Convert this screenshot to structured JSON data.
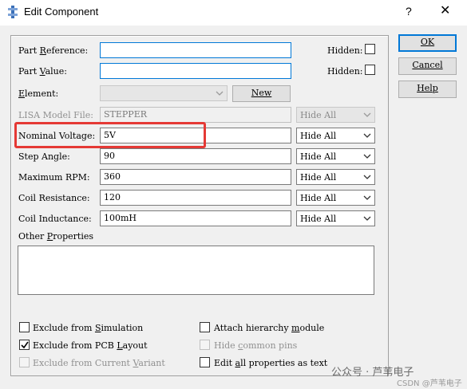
{
  "window": {
    "title": "Edit Component",
    "help_glyph": "?",
    "close_glyph": "✕"
  },
  "buttons": {
    "ok": "OK",
    "cancel": "Cancel",
    "help": "Help",
    "new": "New"
  },
  "fields": {
    "part_reference": {
      "label_pre": "Part ",
      "label_u": "R",
      "label_post": "eference:",
      "value": ""
    },
    "part_value": {
      "label_pre": "Part ",
      "label_u": "V",
      "label_post": "alue:",
      "value": ""
    },
    "element": {
      "label_pre": "",
      "label_u": "E",
      "label_post": "lement:",
      "value": ""
    },
    "hidden_label": "Hidden:"
  },
  "properties": [
    {
      "label": "LISA Model File:",
      "value": "STEPPER",
      "visibility": "Hide All",
      "disabled": true
    },
    {
      "label": "Nominal Voltage:",
      "value": "5V",
      "visibility": "Hide All",
      "disabled": false
    },
    {
      "label": "Step Angle:",
      "value": "90",
      "visibility": "Hide All",
      "disabled": false
    },
    {
      "label": "Maximum RPM:",
      "value": "360",
      "visibility": "Hide All",
      "disabled": false
    },
    {
      "label": "Coil Resistance:",
      "value": "120",
      "visibility": "Hide All",
      "disabled": false
    },
    {
      "label": "Coil Inductance:",
      "value": "100mH",
      "visibility": "Hide All",
      "disabled": false
    }
  ],
  "other_properties": {
    "label_pre": "Other ",
    "label_u": "P",
    "label_post": "roperties",
    "value": ""
  },
  "options": {
    "exclude_simulation": {
      "pre": "Exclude from ",
      "u": "S",
      "post": "imulation",
      "checked": false
    },
    "exclude_pcb": {
      "pre": "Exclude from PCB ",
      "u": "L",
      "post": "ayout",
      "checked": true
    },
    "exclude_variant": {
      "pre": "Exclude from Current ",
      "u": "V",
      "post": "ariant",
      "checked": false,
      "disabled": true
    },
    "attach_hierarchy": {
      "pre": "Attach hierarchy ",
      "u": "m",
      "post": "odule",
      "checked": false
    },
    "hide_common_pins": {
      "pre": "Hide ",
      "u": "c",
      "post": "ommon pins",
      "checked": false,
      "disabled": true
    },
    "edit_all": {
      "pre": "Edit ",
      "u": "a",
      "post": "ll properties as text",
      "checked": false
    }
  },
  "watermark": {
    "line1": "公众号 · 芦苇电子",
    "line2": "CSDN @芦苇电子"
  },
  "colors": {
    "highlight": "#e53935",
    "accent": "#0078d7"
  }
}
